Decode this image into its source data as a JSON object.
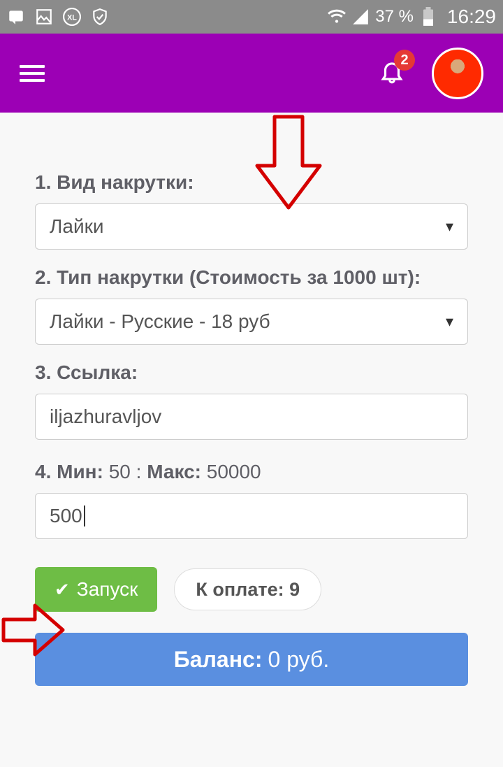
{
  "status": {
    "battery_pct": "37 %",
    "time": "16:29"
  },
  "header": {
    "notif_count": "2"
  },
  "form": {
    "kind_label": "1. Вид накрутки:",
    "kind_value": "Лайки",
    "type_label": "2. Тип накрутки (Стоимость за 1000 шт):",
    "type_value": "Лайки - Русские - 18 руб",
    "link_label": "3. Ссылка:",
    "link_value": "iljazhuravljov",
    "minmax_prefix": "4. ",
    "min_label": "Мин:",
    "min_value": "50",
    "sep": ":",
    "max_label": "Макс:",
    "max_value": "50000",
    "amount_value": "500"
  },
  "actions": {
    "run_label": "Запуск",
    "pay_label": "К оплате: 9"
  },
  "balance": {
    "label": "Баланс:",
    "value": "0 руб."
  }
}
